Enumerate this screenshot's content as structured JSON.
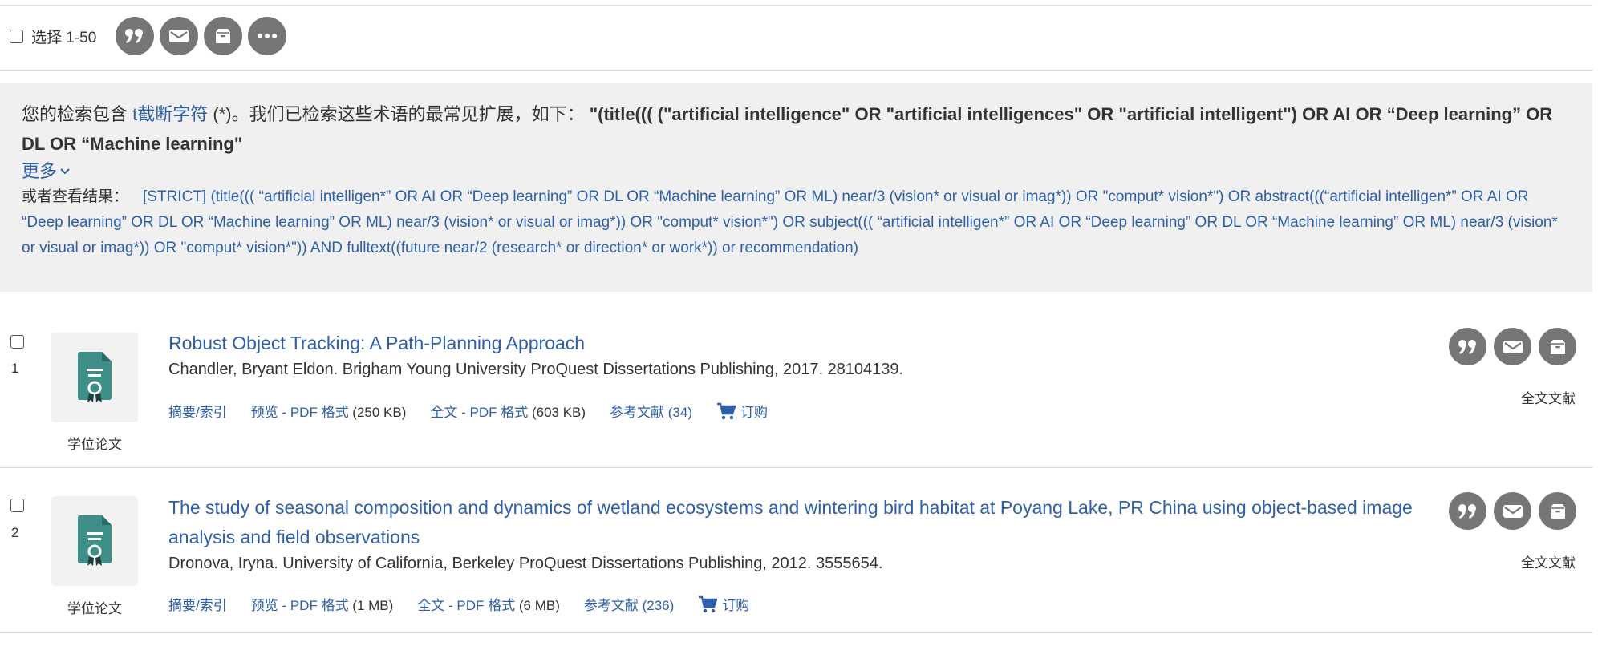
{
  "toolbar": {
    "select_label": "选择 1-50",
    "icons": [
      "cite-icon",
      "email-icon",
      "save-icon",
      "more-icon"
    ]
  },
  "notice": {
    "prefix": "您的检索包含 ",
    "truncation_link": "t截断字符",
    "middle": " (*)。我们已检索这些术语的最常见扩展，如下：",
    "query": " \"(title((( (\"artificial intelligence\" OR \"artificial intelligences\" OR \"artificial intelligent\") OR AI OR “Deep learning” OR DL OR “Machine learning\"",
    "more_label": "更多",
    "alt_label": "或者查看结果：",
    "alt_query": "[STRICT] (title((( “artificial intelligen*” OR AI OR “Deep learning” OR DL OR “Machine learning” OR ML) near/3 (vision* or visual or imag*)) OR \"comput* vision*\") OR abstract(((“artificial intelligen*” OR AI OR “Deep learning” OR DL OR “Machine learning” OR ML) near/3 (vision* or visual or imag*)) OR \"comput* vision*\") OR subject((( “artificial intelligen*” OR AI OR “Deep learning” OR DL OR “Machine learning” OR ML) near/3 (vision* or visual or imag*)) OR \"comput* vision*\")) AND fulltext((future near/2 (research* or direction* or work*)) or recommendation)"
  },
  "results": [
    {
      "number": "1",
      "doc_type": "学位论文",
      "title": "Robust Object Tracking: A Path-Planning Approach",
      "meta": "Chandler, Bryant Eldon.  Brigham Young University ProQuest Dissertations Publishing,  2017. 28104139.",
      "abstract_label": "摘要/索引",
      "preview_label": "预览 - PDF 格式",
      "preview_size": " (250 KB)",
      "fulltext_label": "全文 - PDF 格式",
      "fulltext_size": " (603 KB)",
      "refs_label": "参考文献 (34)",
      "order_label": "订购",
      "fulltext_badge": "全文文献"
    },
    {
      "number": "2",
      "doc_type": "学位论文",
      "title": "The study of seasonal composition and dynamics of wetland ecosystems and wintering bird habitat at Poyang Lake, PR China using object-based image analysis and field observations",
      "meta": "Dronova, Iryna.  University of California, Berkeley ProQuest Dissertations Publishing,  2012. 3555654.",
      "abstract_label": "摘要/索引",
      "preview_label": "预览 - PDF 格式",
      "preview_size": " (1 MB)",
      "fulltext_label": "全文 - PDF 格式",
      "fulltext_size": " (6 MB)",
      "refs_label": "参考文献 (236)",
      "order_label": "订购",
      "fulltext_badge": "全文文献"
    }
  ],
  "colors": {
    "link": "#2e5fa8",
    "icon_button": "#767676",
    "thesis_icon": "#3d8f88",
    "notice_bg": "#f0f0f0"
  }
}
